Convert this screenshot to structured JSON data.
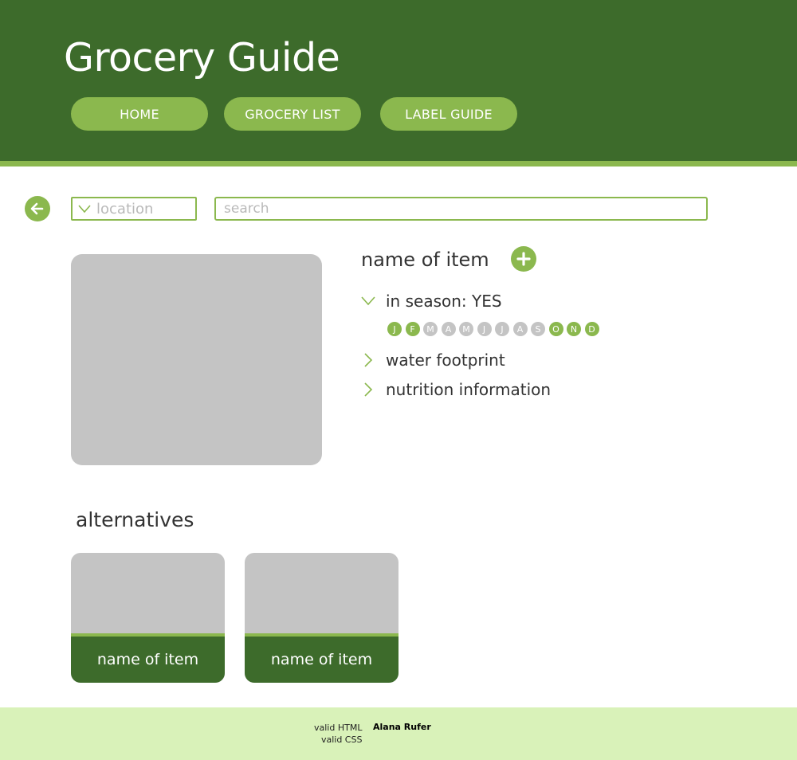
{
  "header": {
    "title": "Grocery Guide",
    "nav": [
      {
        "label": "HOME"
      },
      {
        "label": "GROCERY LIST"
      },
      {
        "label": "LABEL GUIDE"
      }
    ]
  },
  "toolbar": {
    "back_icon": "arrow-left-icon",
    "location_label": "location",
    "search_placeholder": "search"
  },
  "item": {
    "name": "name of item",
    "add_icon": "plus-icon",
    "in_season_label": "in season: YES",
    "months": [
      {
        "letter": "J",
        "in_season": true
      },
      {
        "letter": "F",
        "in_season": true
      },
      {
        "letter": "M",
        "in_season": false
      },
      {
        "letter": "A",
        "in_season": false
      },
      {
        "letter": "M",
        "in_season": false
      },
      {
        "letter": "J",
        "in_season": false
      },
      {
        "letter": "J",
        "in_season": false
      },
      {
        "letter": "A",
        "in_season": false
      },
      {
        "letter": "S",
        "in_season": false
      },
      {
        "letter": "O",
        "in_season": true
      },
      {
        "letter": "N",
        "in_season": true
      },
      {
        "letter": "D",
        "in_season": true
      }
    ],
    "water_label": "water footprint",
    "nutrition_label": "nutrition information"
  },
  "alternatives": {
    "heading": "alternatives",
    "items": [
      {
        "name": "name of item"
      },
      {
        "name": "name of item"
      }
    ]
  },
  "footer": {
    "valid_html": "valid HTML",
    "valid_css": "valid CSS",
    "author": "Alana Rufer"
  },
  "colors": {
    "dark_green": "#3d6b2b",
    "light_green": "#8bb84e",
    "footer_bg": "#d9f2b9",
    "placeholder_gray": "#c4c4c4"
  }
}
